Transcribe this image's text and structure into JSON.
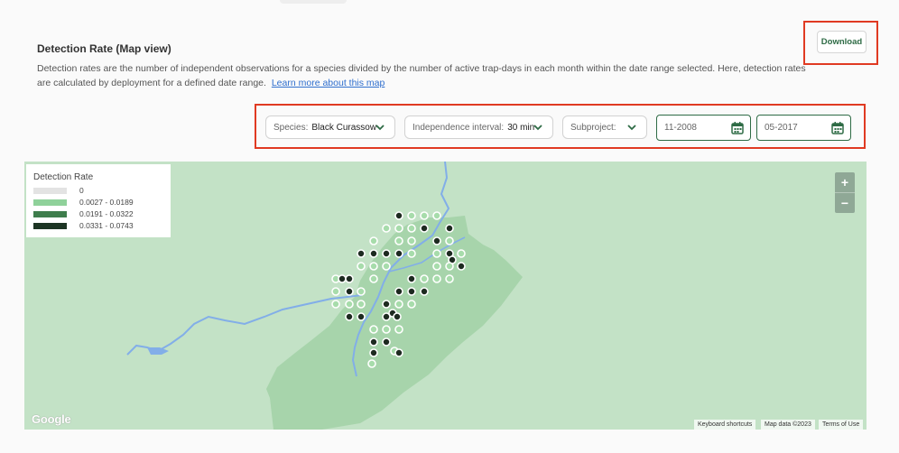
{
  "header": {
    "title": "Detection Rate (Map view)",
    "description": "Detection rates are the number of independent observations for a species divided by the number of active trap-days in each month within the date range selected. Here, detection rates are calculated by deployment for a defined date range.",
    "learn_more_link": "Learn more about this map",
    "download_label": "Download"
  },
  "filters": {
    "species": {
      "label": "Species:",
      "value": "Black Curassow"
    },
    "interval": {
      "label": "Independence interval:",
      "value": "30 min"
    },
    "subproject": {
      "label": "Subproject:",
      "value": ""
    },
    "start_date": "11-2008",
    "end_date": "05-2017"
  },
  "legend": {
    "title": "Detection Rate",
    "entries": [
      {
        "label": "0",
        "color": "#e3e3e3"
      },
      {
        "label": "0.0027 - 0.0189",
        "color": "#8fd19a"
      },
      {
        "label": "0.0191 - 0.0322",
        "color": "#3e7d4c"
      },
      {
        "label": "0.0331 - 0.0743",
        "color": "#1d3524"
      }
    ]
  },
  "map": {
    "zoom_in": "+",
    "zoom_out": "−",
    "google_logo": "Google",
    "keyboard_shortcuts": "Keyboard shortcuts",
    "map_data": "Map data ©2023",
    "terms": "Terms of Use"
  },
  "colors": {
    "accent_green": "#2e6b45",
    "highlight_red": "#e03a22",
    "link_blue": "#2f6fce",
    "map_bg": "#c3e2c6",
    "reserve_area": "#a7d4ab",
    "river": "#82aee8"
  }
}
